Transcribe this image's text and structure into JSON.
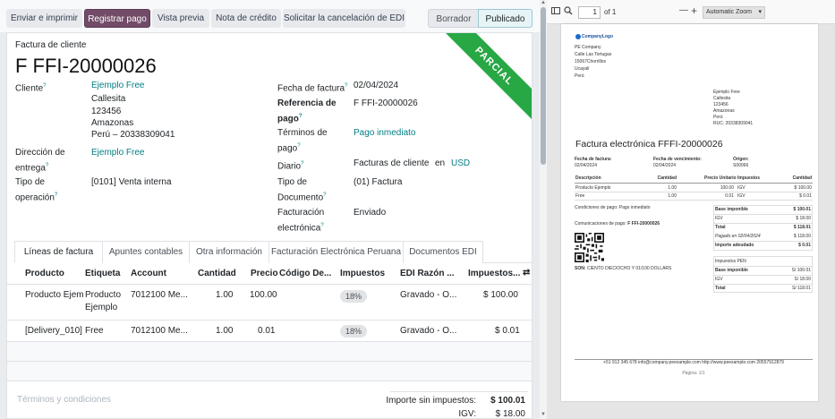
{
  "toolbar": {
    "send_print": "Enviar e imprimir",
    "register_payment": "Registrar pago",
    "preview": "Vista previa",
    "credit_note": "Nota de crédito",
    "edi_cancel": "Solicitar la cancelación de EDI",
    "status_draft": "Borrador",
    "status_posted": "Publicado"
  },
  "form": {
    "ribbon": "PARCIAL",
    "doc_type": "Factura de cliente",
    "number": "F FFI-20000026",
    "customer_label": "Cliente",
    "customer_name": "Ejemplo Free",
    "customer_address": [
      "Callesita",
      "123456",
      "Amazonas",
      "Perú – 20338309041"
    ],
    "delivery_label_1": "Dirección de",
    "delivery_label_2": "entrega",
    "delivery_value": "Ejemplo Free",
    "operation_label_1": "Tipo de",
    "operation_label_2": "operación",
    "operation_value": "[0101] Venta interna",
    "invoice_date_label": "Fecha de factura",
    "invoice_date": "02/04/2024",
    "reference_label_1": "Referencia de",
    "reference_label_2": "pago",
    "reference_value": "F FFI-20000026",
    "terms_label_1": "Términos de",
    "terms_label_2": "pago",
    "terms_value": "Pago inmediato",
    "journal_label": "Diario",
    "journal_value": "Facturas de cliente",
    "journal_in": "en",
    "currency": "USD",
    "doctype_label_1": "Tipo de",
    "doctype_label_2": "Documento",
    "doctype_value": "(01) Factura",
    "einvoice_label_1": "Facturación",
    "einvoice_label_2": "electrónica",
    "einvoice_value": "Enviado",
    "help_mark": "?"
  },
  "tabs": [
    "Líneas de factura",
    "Apuntes contables",
    "Otra información",
    "Facturación Electrónica Peruana",
    "Documentos EDI"
  ],
  "table": {
    "headers": [
      "Producto",
      "Etiqueta",
      "Account",
      "Cantidad",
      "Precio",
      "Código De...",
      "Impuestos",
      "EDI Razón ...",
      "Impuestos..."
    ],
    "rows": [
      {
        "product": "Producto Ejemp",
        "label_1": "Producto",
        "label_2": "Ejemplo",
        "account": "7012100 Me...",
        "qty": "1.00",
        "price": "100.00",
        "tax": "18%",
        "edi": "Gravado - O...",
        "subtotal": "$ 100.00"
      },
      {
        "product": "[Delivery_010] E",
        "label_1": "Free",
        "label_2": "",
        "account": "7012100 Me...",
        "qty": "1.00",
        "price": "0.01",
        "tax": "18%",
        "edi": "Gravado - O...",
        "subtotal": "$ 0.01"
      }
    ]
  },
  "footer": {
    "terms_placeholder": "Términos y condiciones",
    "untaxed_label": "Importe sin impuestos:",
    "untaxed_value": "$ 100.01",
    "igv_label": "IGV:",
    "igv_value": "$ 18.00"
  },
  "viewer": {
    "page_current": "1",
    "page_of": "of 1",
    "zoom_minus": "—",
    "zoom_plus": "+",
    "zoom": "Automatic Zoom"
  },
  "pdf": {
    "logo": "CompanyLogo",
    "company": [
      "PE Company",
      "Calle Las Tortugas",
      "15067Chorrillos",
      "Ucayali",
      "Perú"
    ],
    "client": [
      "Ejemplo Free",
      "Callesita",
      "123456",
      "Amazonas",
      "Perú",
      "RUC: 20338309041"
    ],
    "title": "Factura electrónica FFFI-20000026",
    "invoice_date_label": "Fecha de factura:",
    "invoice_date": "02/04/2024",
    "due_label": "Fecha de vencimiento:",
    "due_date": "02/04/2024",
    "origin_label": "Origen:",
    "origin": "S00066",
    "headers": [
      "Descripción",
      "Cantidad",
      "Precio Unitario",
      "Impuestos",
      "Cantidad"
    ],
    "lines": [
      {
        "desc": "Producto Ejemplo",
        "qty": "1.00",
        "unit": "100.00",
        "tax": "IGV",
        "amount": "$ 100.00"
      },
      {
        "desc": "Free",
        "qty": "1.00",
        "unit": "0.01",
        "tax": "IGV",
        "amount": "$ 0.01"
      }
    ],
    "payment_terms": "Condiciones de pago: Pago inmediato",
    "communication": "Comunicaciones de pago:",
    "communication_ref": "F FFI-20000026",
    "totals": [
      {
        "label": "Base imponible",
        "value": "$ 100.01",
        "bold": true
      },
      {
        "label": "IGV",
        "value": "$ 18.00",
        "bold": false
      },
      {
        "label": "Total",
        "value": "$ 118.01",
        "bold": true
      },
      {
        "label": "Pagado en 02/04/2024",
        "value": "$ 118.00",
        "bold": false,
        "italic": true
      },
      {
        "label": "Importe adeudado",
        "value": "$ 0.01",
        "bold": true
      }
    ],
    "pen_title": "Impuestos PEN",
    "pen": [
      {
        "label": "Base imponible",
        "value": "S/ 100.01",
        "bold": true
      },
      {
        "label": "IGV",
        "value": "S/ 18.00",
        "bold": false
      },
      {
        "label": "Total",
        "value": "S/ 118.01",
        "bold": true
      }
    ],
    "son_label": "SON:",
    "son": "CIENTO DIECIOCHO Y 01/100 DOLLARS",
    "footer": "+51 912 345 678 info@company.peexample.com http://www.peexample.com 20557912879",
    "page": "Página: 1/1"
  },
  "colors": {
    "primary": "#714b67",
    "link": "#017e84",
    "ribbon": "#28a745"
  }
}
